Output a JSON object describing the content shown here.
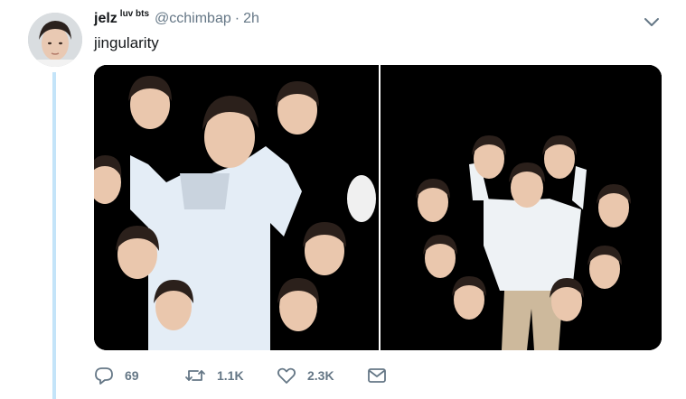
{
  "tweet": {
    "display_name": "jelz",
    "name_suffix": "luv bts",
    "handle": "@cchimbap",
    "separator": "·",
    "time": "2h",
    "text": "jingularity"
  },
  "actions": {
    "reply_count": "69",
    "retweet_count": "1.1K",
    "like_count": "2.3K"
  },
  "icons": {
    "reply": "speech-bubble-icon",
    "retweet": "retweet-arrows-icon",
    "like": "heart-icon",
    "message": "envelope-icon",
    "menu": "chevron-down-icon"
  },
  "colors": {
    "text": "#14171a",
    "muted": "#657786",
    "thread_line": "#c4e4f9",
    "media_background": "#000000"
  }
}
